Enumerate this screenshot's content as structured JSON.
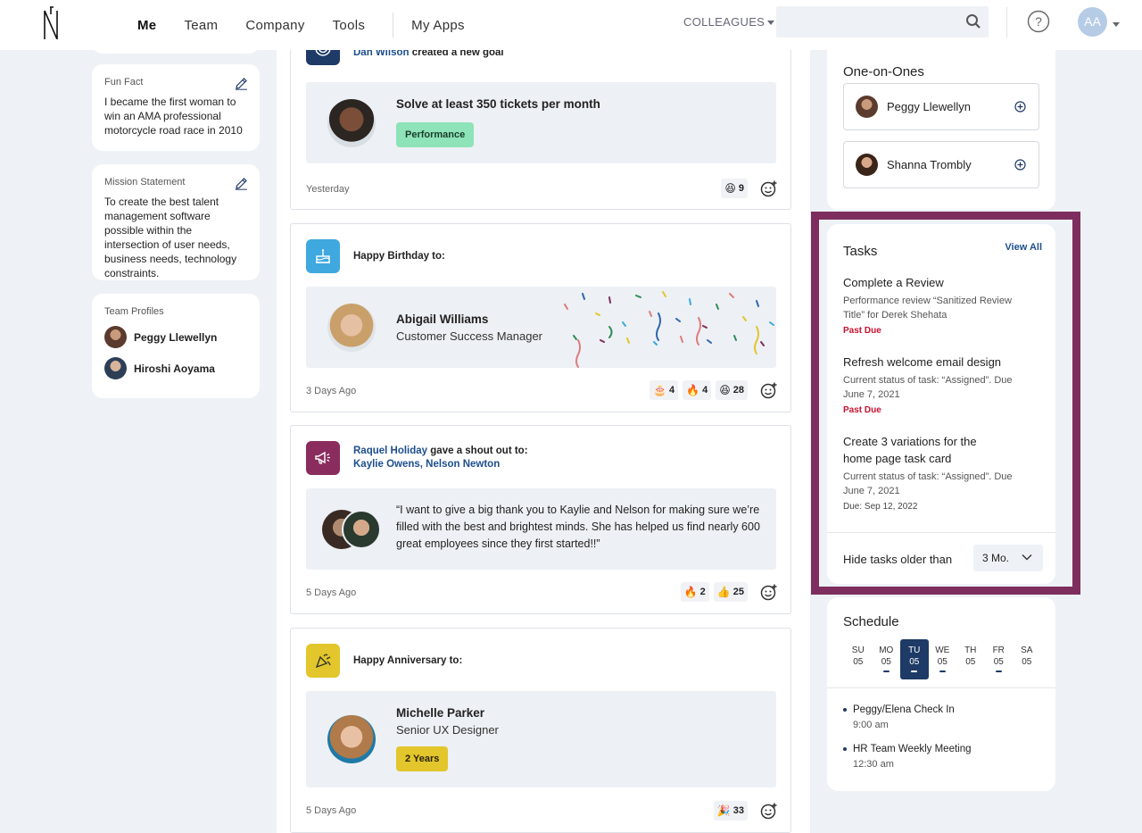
{
  "nav": {
    "links": [
      "Me",
      "Team",
      "Company",
      "Tools",
      "My Apps"
    ],
    "colleagues": "COLLEAGUES",
    "search_placeholder": "",
    "avatar_initials": "AA"
  },
  "left": {
    "fun_fact": {
      "label": "Fun Fact",
      "text": "I became the first woman to win an AMA professional motorcycle road race in 2010"
    },
    "mission": {
      "label": "Mission Statement",
      "text": "To create the best talent management software possible within the intersection of user needs, business needs, technology constraints."
    },
    "team_profiles": {
      "label": "Team Profiles",
      "people": [
        "Peggy Llewellyn",
        "Hiroshi Aoyama"
      ]
    }
  },
  "feed": {
    "goal": {
      "actor": "Dan Wilson",
      "action": "created a new goal",
      "title": "Solve at least 350 tickets per month",
      "tag": "Performance",
      "time": "Yesterday",
      "reactions": [
        {
          "emoji": "😆",
          "count": "9"
        }
      ]
    },
    "birthday": {
      "heading": "Happy Birthday to:",
      "name": "Abigail Williams",
      "role": "Customer Success Manager",
      "time": "3 Days Ago",
      "reactions": [
        {
          "emoji": "🎂",
          "count": "4"
        },
        {
          "emoji": "🔥",
          "count": "4"
        },
        {
          "emoji": "😆",
          "count": "28"
        }
      ]
    },
    "shoutout": {
      "actor": "Raquel Holiday",
      "action": "gave a shout out to:",
      "targets": "Kaylie Owens, Nelson Newton",
      "quote": "“I want to give a big thank you to Kaylie and Nelson for making sure we’re filled with the best and brightest minds. She has helped us find nearly 600 great employees since they first started!!”",
      "time": "5 Days Ago",
      "reactions": [
        {
          "emoji": "🔥",
          "count": "2"
        },
        {
          "emoji": "👍",
          "count": "25"
        }
      ]
    },
    "anniversary": {
      "heading": "Happy Anniversary to:",
      "name": "Michelle Parker",
      "role": "Senior UX Designer",
      "tag": "2 Years",
      "time": "5 Days Ago",
      "reactions": [
        {
          "emoji": "🎉",
          "count": "33"
        }
      ]
    }
  },
  "one_on_ones": {
    "title": "One-on-Ones",
    "people": [
      "Peggy Llewellyn",
      "Shanna Trombly"
    ]
  },
  "tasks": {
    "title": "Tasks",
    "view_all": "View All",
    "items": [
      {
        "title": "Complete a Review",
        "desc": "Performance review “Sanitized Review Title” for Derek Shehata",
        "due": "Past Due"
      },
      {
        "title": "Refresh welcome email design",
        "desc": "Current status of task: “Assigned”. Due June 7, 2021",
        "due": "Past Due"
      },
      {
        "title": "Create 3 variations for the home page task card",
        "desc": "Current status of task: “Assigned”. Due June 7, 2021",
        "due": "Due: Sep 12, 2022"
      }
    ],
    "hide_label": "Hide tasks older than",
    "hide_value": "3 Mo."
  },
  "schedule": {
    "title": "Schedule",
    "days": [
      {
        "d": "SU",
        "n": "05",
        "dot": false
      },
      {
        "d": "MO",
        "n": "05",
        "dot": true
      },
      {
        "d": "TU",
        "n": "05",
        "dot": true
      },
      {
        "d": "WE",
        "n": "05",
        "dot": true
      },
      {
        "d": "TH",
        "n": "05",
        "dot": false
      },
      {
        "d": "FR",
        "n": "05",
        "dot": true
      },
      {
        "d": "SA",
        "n": "05",
        "dot": false
      }
    ],
    "events": [
      {
        "name": "Peggy/Elena Check In",
        "time": "9:00 am"
      },
      {
        "name": "HR Team Weekly Meeting",
        "time": "12:30 am"
      }
    ]
  },
  "colors": {
    "accent": "#1d4e8f",
    "frame": "#7d2e5e",
    "past_due": "#c8102e",
    "perf_tag": "#8ee3b8",
    "years_tag": "#e2c62b"
  }
}
